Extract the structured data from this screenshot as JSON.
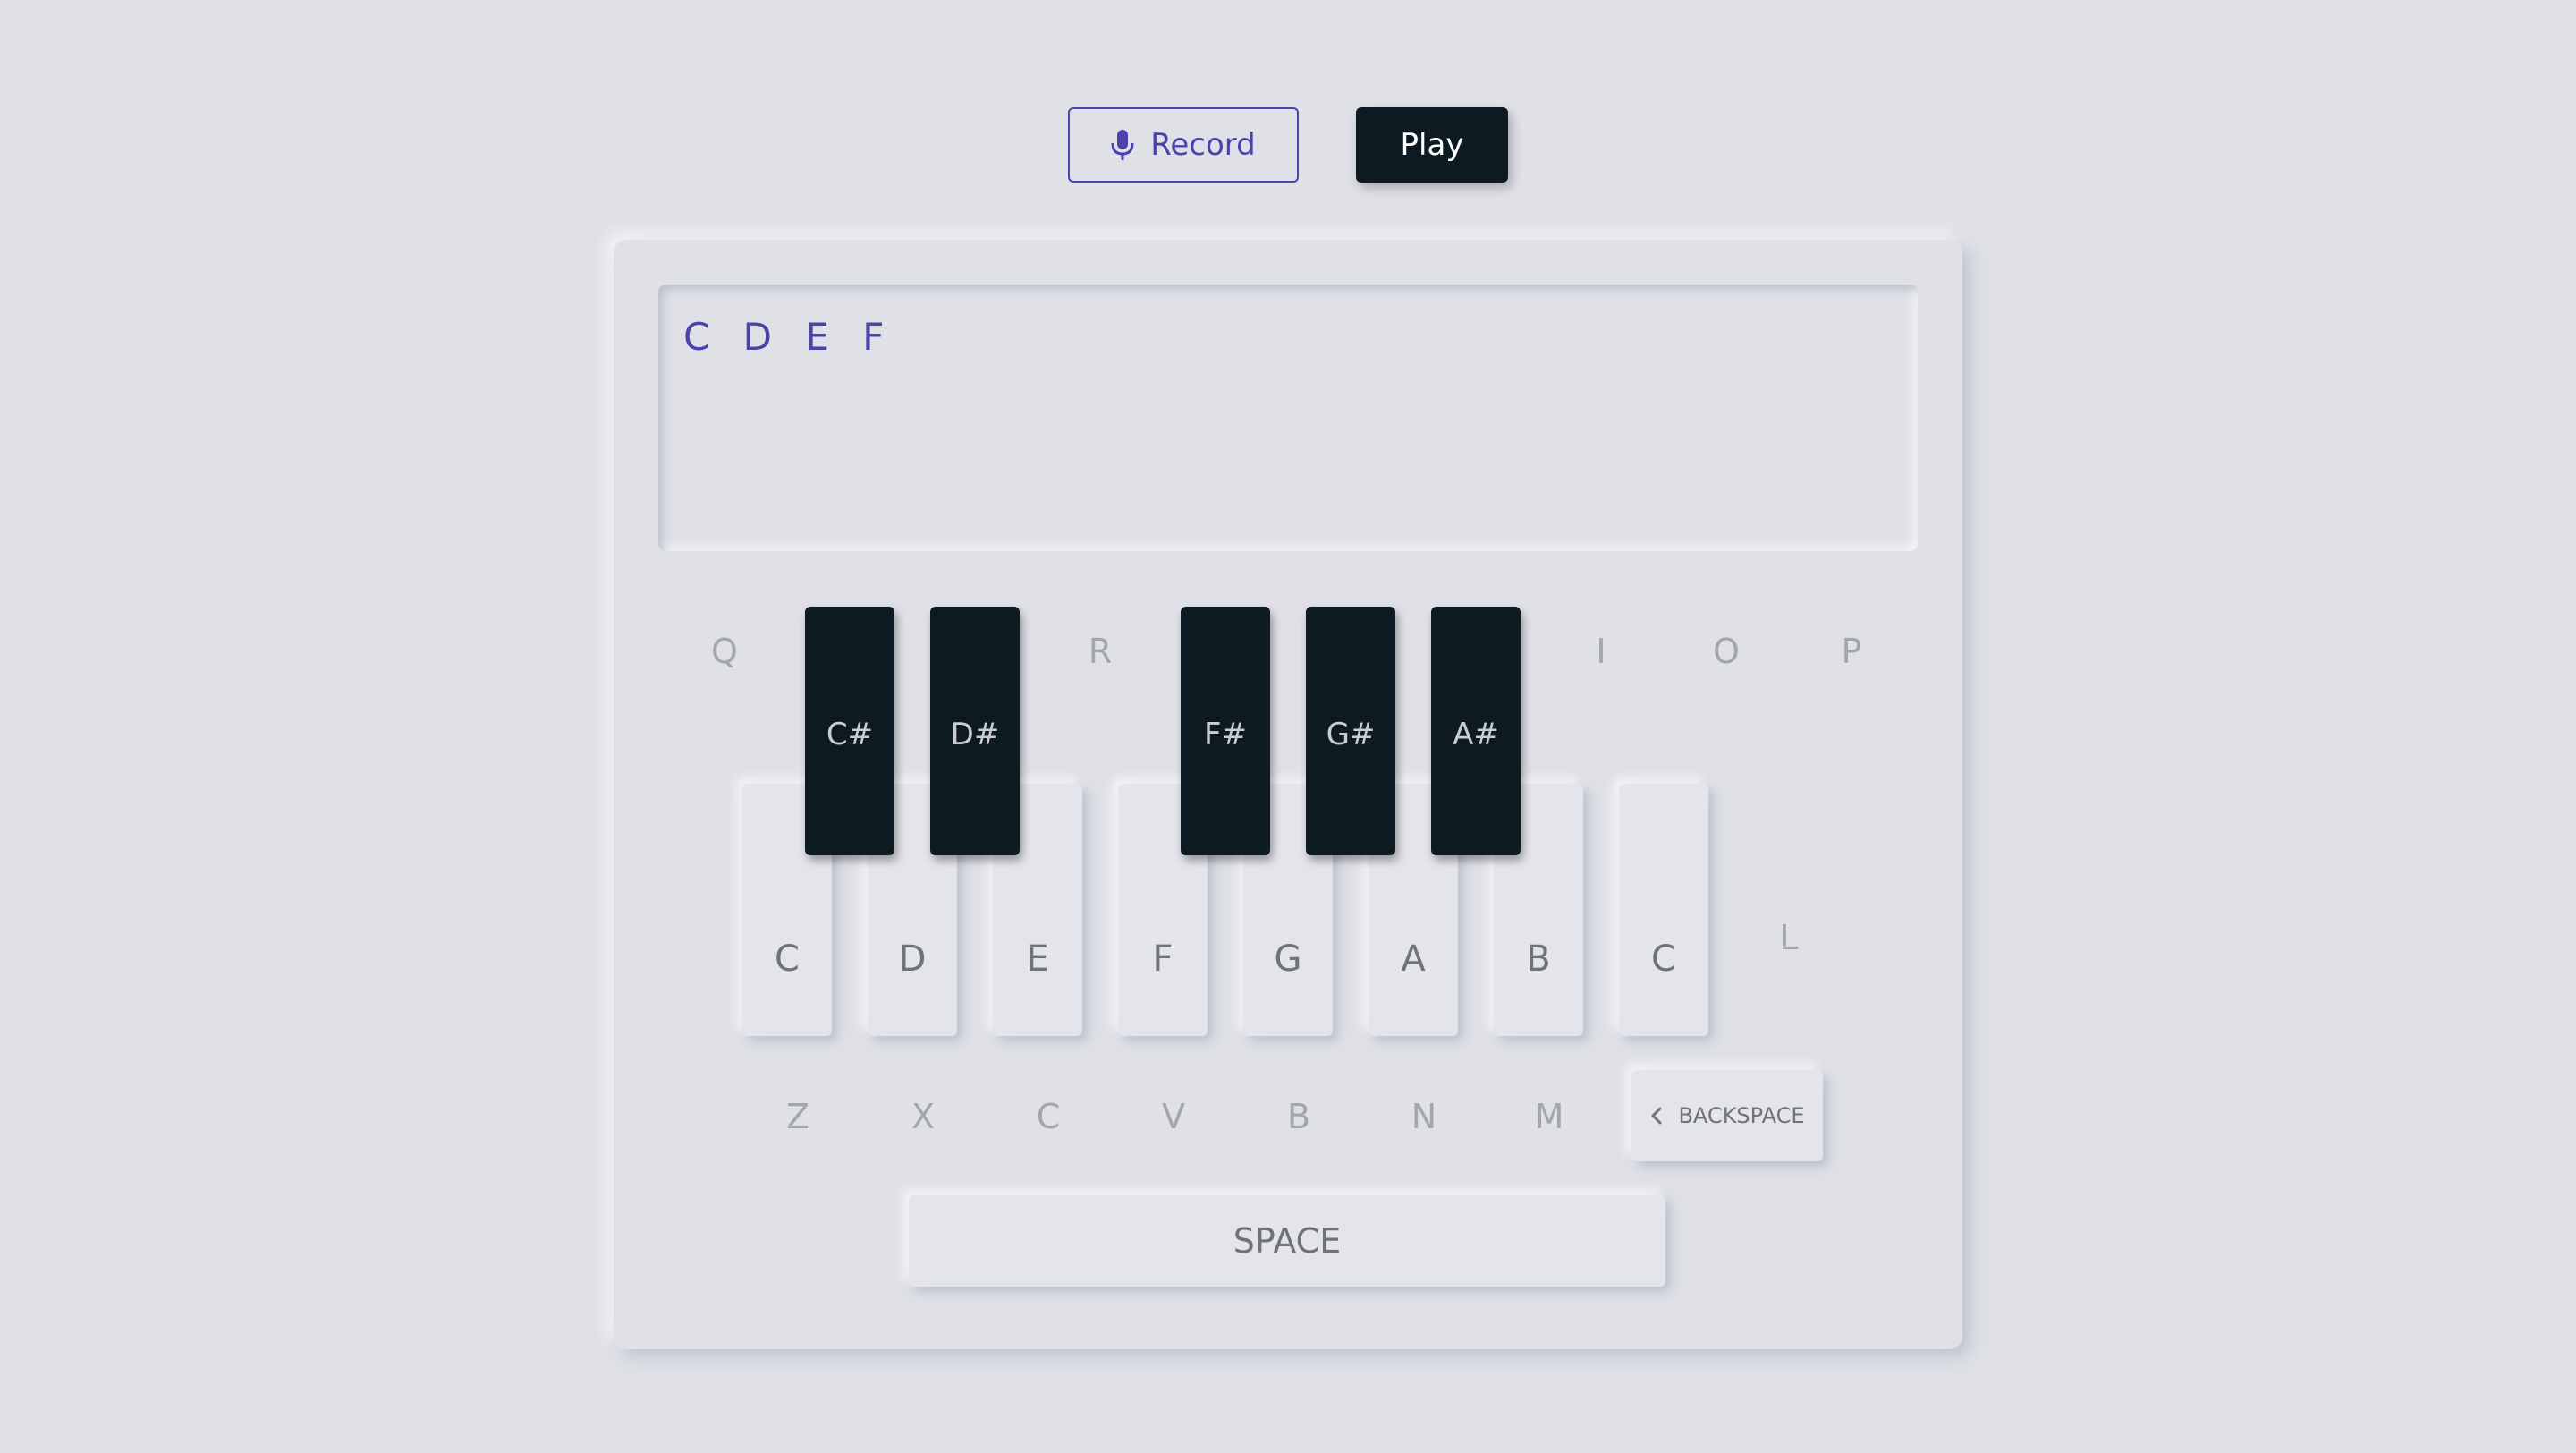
{
  "controls": {
    "record_label": "Record",
    "play_label": "Play",
    "record_icon": "microphone-icon"
  },
  "display": {
    "notes": "C D E F"
  },
  "top_row_hints": [
    "Q",
    "R",
    "I",
    "O",
    "P"
  ],
  "side_hint": "L",
  "black_keys": [
    "C#",
    "D#",
    "F#",
    "G#",
    "A#"
  ],
  "white_keys": [
    "C",
    "D",
    "E",
    "F",
    "G",
    "A",
    "B",
    "C"
  ],
  "bottom_row_hints": [
    "Z",
    "X",
    "C",
    "V",
    "B",
    "N",
    "M"
  ],
  "backspace": {
    "label": "BACKSPACE",
    "icon": "chevron-left-icon"
  },
  "space": {
    "label": "SPACE"
  },
  "colors": {
    "background": "#dfe1e7",
    "accent": "#4b44a8",
    "dark_key": "#0e1a22",
    "hint": "#a3a6ad"
  }
}
